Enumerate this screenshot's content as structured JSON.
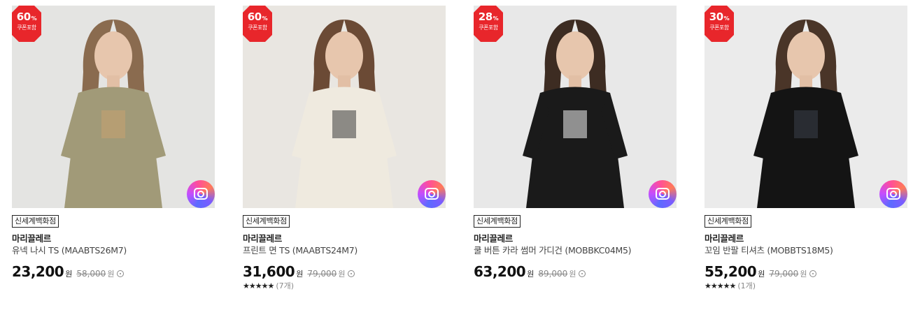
{
  "colors": {
    "badge": "#e8262b",
    "text": "#222222",
    "muted": "#888888"
  },
  "products": [
    {
      "discount": "60",
      "percent_sign": "%",
      "badge_sub": "쿠폰포함",
      "store": "신세계백화점",
      "brand": "마리끌레르",
      "name": "유넥 나시 TS (MAABTS26M7)",
      "price": "23,200",
      "won": "원",
      "original_price": "58,000",
      "original_won": "원",
      "stars": "",
      "review_count": "",
      "photo": {
        "bg": "#e4e4e2",
        "garment": "#a19a78",
        "hair": "#8a6b4f",
        "accent": "#c9a36f"
      }
    },
    {
      "discount": "60",
      "percent_sign": "%",
      "badge_sub": "쿠폰포함",
      "store": "신세계백화점",
      "brand": "마리끌레르",
      "name": "프린트 면 TS (MAABTS24M7)",
      "price": "31,600",
      "won": "원",
      "original_price": "79,000",
      "original_won": "원",
      "stars": "★★★★★",
      "review_count": "(7개)",
      "photo": {
        "bg": "#e9e6e1",
        "garment": "#efeadf",
        "hair": "#6b4a35",
        "accent": "#3a3a3a"
      }
    },
    {
      "discount": "28",
      "percent_sign": "%",
      "badge_sub": "쿠폰포함",
      "store": "신세계백화점",
      "brand": "마리끌레르",
      "name": "쿨 버튼 카라 썸머 가디건 (MOBBKC04M5)",
      "price": "63,200",
      "won": "원",
      "original_price": "89,000",
      "original_won": "원",
      "stars": "",
      "review_count": "",
      "photo": {
        "bg": "#e8e8e8",
        "garment": "#1a1a1a",
        "hair": "#3d2c22",
        "accent": "#f2f2f2"
      }
    },
    {
      "discount": "30",
      "percent_sign": "%",
      "badge_sub": "쿠폰포함",
      "store": "신세계백화점",
      "brand": "마리끌레르",
      "name": "꼬임 반팔 티셔츠 (MOBBTS18M5)",
      "price": "55,200",
      "won": "원",
      "original_price": "79,000",
      "original_won": "원",
      "stars": "★★★★★",
      "review_count": "(1개)",
      "photo": {
        "bg": "#ebebeb",
        "garment": "#141414",
        "hair": "#4a3528",
        "accent": "#3a3f4a"
      }
    }
  ]
}
